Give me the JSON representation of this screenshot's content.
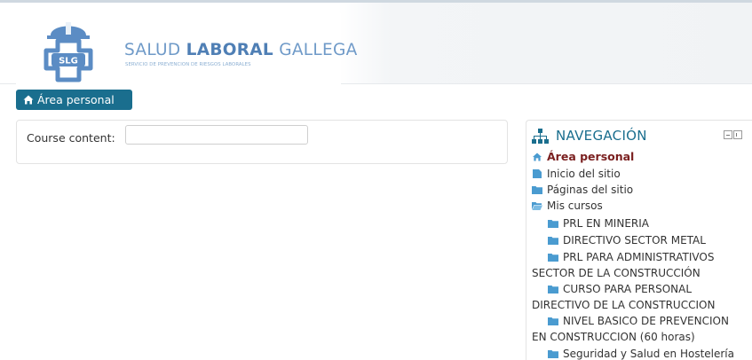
{
  "header": {
    "brand_main_light": "SALUD",
    "brand_main_bold": "LABORAL",
    "brand_main_end": "GALLEGA",
    "brand_sub": "SERVICIO DE PREVENCION DE RIESGOS LABORALES",
    "logo_text": "SLG"
  },
  "breadcrumb": {
    "home_label": "Área personal"
  },
  "main": {
    "course_content_label": "Course content:",
    "course_content_value": ""
  },
  "navigation": {
    "title": "NAVEGACIÓN",
    "current": "Área personal",
    "items": [
      "Inicio del sitio",
      "Páginas del sitio",
      "Mis cursos"
    ],
    "courses": [
      {
        "line1": "PRL EN MINERIA"
      },
      {
        "line1": "DIRECTIVO SECTOR METAL"
      },
      {
        "line1": "PRL PARA ADMINISTRATIVOS",
        "line2": "SECTOR DE LA CONSTRUCCIÓN"
      },
      {
        "line1": "CURSO PARA PERSONAL",
        "line2": "DIRECTIVO DE LA CONSTRUCCION"
      },
      {
        "line1": "NIVEL BASICO DE PREVENCION",
        "line2": "EN CONSTRUCCION (60 horas)"
      },
      {
        "line1": "Seguridad y Salud en Hostelería"
      }
    ]
  },
  "colors": {
    "accent": "#1a6e8e",
    "current_item": "#7a1f1f",
    "folder": "#4a9bd0",
    "brand": "#5b8cc4"
  },
  "icons": {
    "home": "home-icon",
    "sitemap": "sitemap-icon",
    "page": "page-icon",
    "folder": "folder-icon",
    "folder_open": "folder-open-icon"
  }
}
